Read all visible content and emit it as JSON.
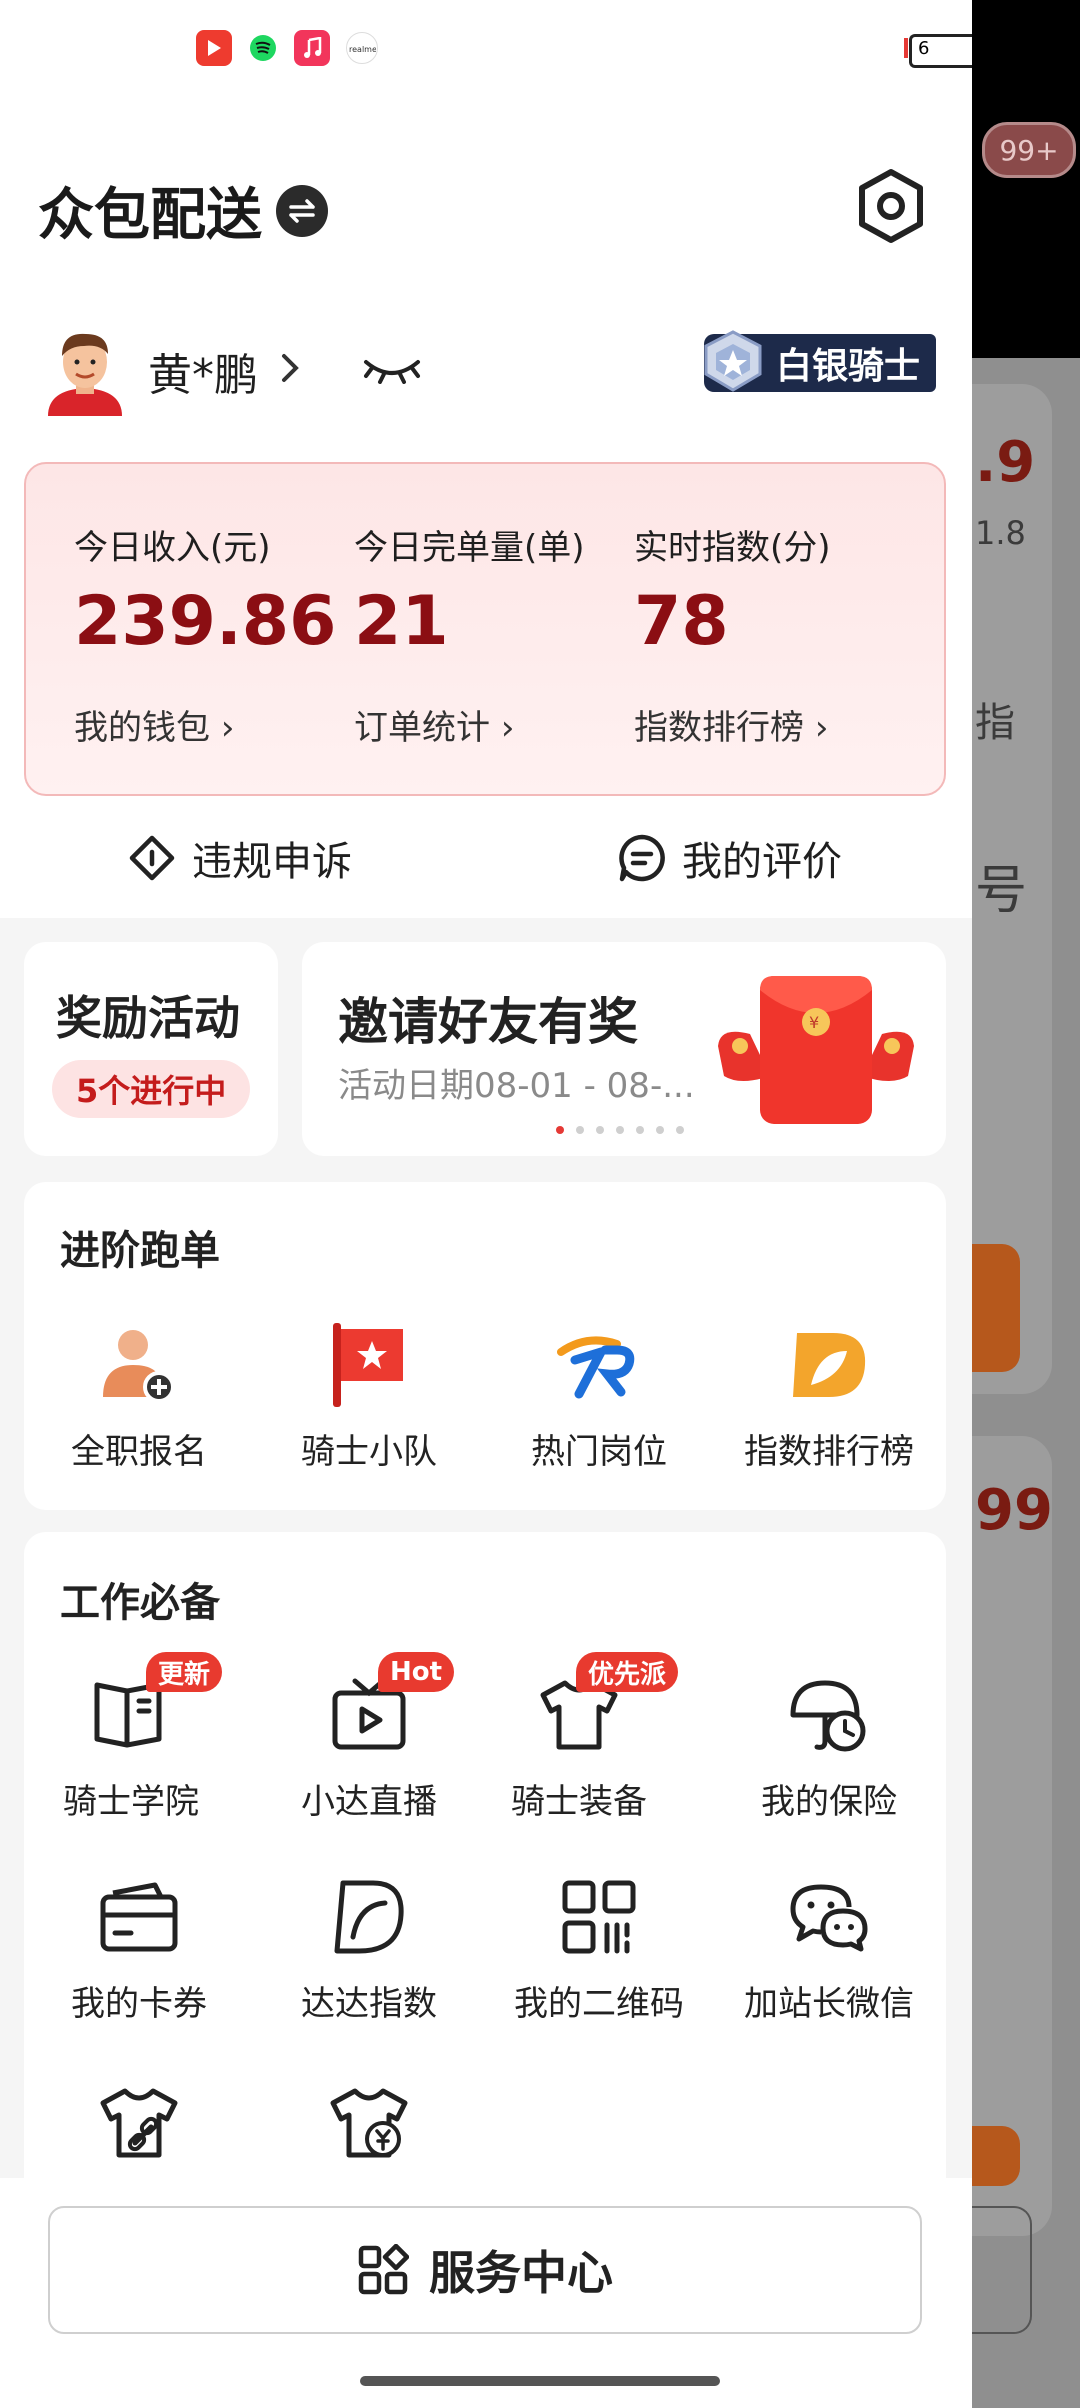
{
  "status_bar": {
    "app_icons": [
      "youtube-music-icon",
      "spotify-icon",
      "music-icon",
      "realme-icon"
    ],
    "battery_text": "6"
  },
  "background": {
    "badge": "99+",
    "text_fragments": [
      ".9",
      "1.8",
      "指",
      "号",
      "99"
    ]
  },
  "header": {
    "title": "众包配送"
  },
  "user": {
    "name": "黄*鹏",
    "rank": "白银骑士"
  },
  "stats": [
    {
      "label": "今日收入(元)",
      "value": "239.86",
      "link": "我的钱包"
    },
    {
      "label": "今日完单量(单)",
      "value": "21",
      "link": "订单统计"
    },
    {
      "label": "实时指数(分)",
      "value": "78",
      "link": "指数排行榜"
    }
  ],
  "actions": {
    "appeal": "违规申诉",
    "rating": "我的评价"
  },
  "reward": {
    "title": "奖励活动",
    "pill": "5个进行中"
  },
  "banner": {
    "title": "邀请好友有奖",
    "subtitle": "活动日期08-01 - 08-...",
    "dots": 7,
    "active_dot": 0
  },
  "advanced": {
    "title": "进阶跑单",
    "items": [
      {
        "label": "全职报名"
      },
      {
        "label": "骑士小队"
      },
      {
        "label": "热门岗位"
      },
      {
        "label": "指数排行榜"
      }
    ]
  },
  "work": {
    "title": "工作必备",
    "items": [
      {
        "label": "骑士学院",
        "tag": "更新"
      },
      {
        "label": "小达直播",
        "tag": "Hot"
      },
      {
        "label": "骑士装备",
        "tag": "优先派"
      },
      {
        "label": "我的保险",
        "tag": ""
      },
      {
        "label": "我的卡券",
        "tag": ""
      },
      {
        "label": "达达指数",
        "tag": ""
      },
      {
        "label": "我的二维码",
        "tag": ""
      },
      {
        "label": "加站长微信",
        "tag": ""
      }
    ]
  },
  "bottom": {
    "service_center": "服务中心"
  },
  "colors": {
    "accent_red": "#8b0e13",
    "tag_red": "#e83a2f",
    "rank_navy": "#1d2a4a"
  }
}
